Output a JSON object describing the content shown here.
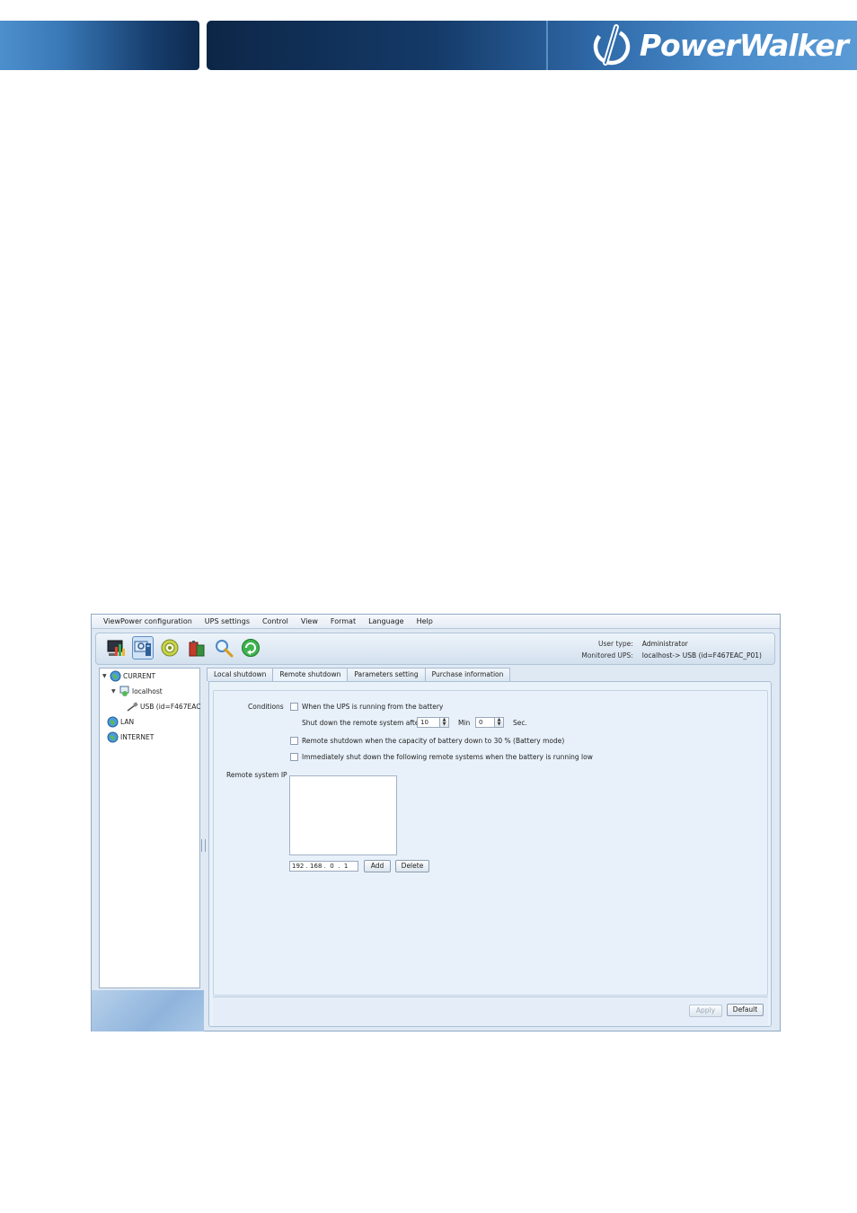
{
  "brand": {
    "name": "PowerWalker"
  },
  "menubar": {
    "items": [
      "ViewPower configuration",
      "UPS settings",
      "Control",
      "View",
      "Format",
      "Language",
      "Help"
    ]
  },
  "toolbar": {
    "icons": [
      "monitor-chart-icon",
      "ups-settings-icon",
      "control-gear-icon",
      "battery-data-icon",
      "search-zoom-icon",
      "refresh-icon"
    ],
    "user_type_label": "User type:",
    "user_type_value": "Administrator",
    "monitored_label": "Monitored UPS:",
    "monitored_value": "localhost-> USB (id=F467EAC_P01)"
  },
  "tree": {
    "current": "CURRENT",
    "localhost": "localhost",
    "usb": "USB (id=F467EAC",
    "lan": "LAN",
    "internet": "INTERNET"
  },
  "tabs": [
    "Local shutdown",
    "Remote shutdown",
    "Parameters setting",
    "Purchase information"
  ],
  "remote": {
    "conditions_label": "Conditions",
    "cond_battery": "When the UPS is running from the battery",
    "shutdown_after": "Shut down the remote system after",
    "min_value": "10",
    "min_label": "Min",
    "sec_value": "0",
    "sec_label": "Sec.",
    "cond_capacity": "Remote shutdown when the capacity of battery down to 30 % (Battery mode)",
    "cond_low": "Immediately shut down the following remote systems when the battery is running low",
    "ip_label": "Remote system IP",
    "ip_value": "192 . 168 .  0  .  1",
    "add_button": "Add",
    "delete_button": "Delete"
  },
  "footer": {
    "apply": "Apply",
    "default": "Default"
  }
}
